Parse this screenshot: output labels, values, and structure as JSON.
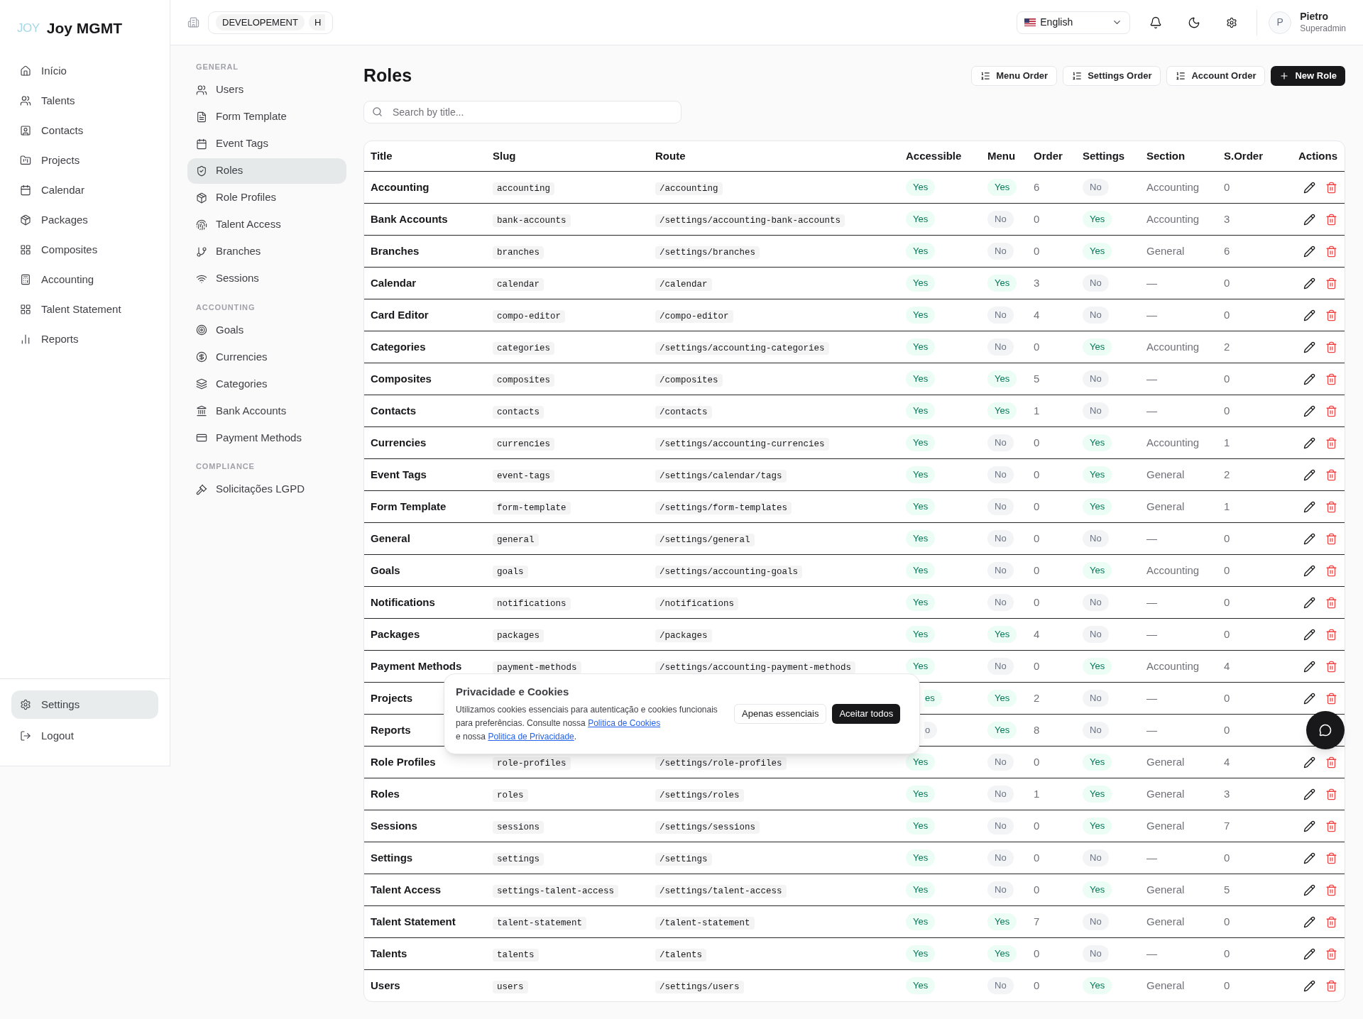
{
  "brand": {
    "mark": "JOY",
    "name": "Joy MGMT"
  },
  "nav": [
    {
      "label": "Início",
      "selected": false
    },
    {
      "label": "Talents",
      "selected": false
    },
    {
      "label": "Contacts",
      "selected": false
    },
    {
      "label": "Projects",
      "selected": false
    },
    {
      "label": "Calendar",
      "selected": false
    },
    {
      "label": "Packages",
      "selected": false
    },
    {
      "label": "Composites",
      "selected": false
    },
    {
      "label": "Accounting",
      "selected": false
    },
    {
      "label": "Talent Statement",
      "selected": false
    },
    {
      "label": "Reports",
      "selected": false
    }
  ],
  "footer_nav": [
    {
      "label": "Settings",
      "selected": true
    },
    {
      "label": "Logout",
      "selected": false
    }
  ],
  "topbar": {
    "environment": "DEVELOPEMENT",
    "branch": "H",
    "language": "English",
    "user": {
      "initial": "P",
      "name": "Pietro",
      "role": "Superadmin"
    }
  },
  "settings_nav": [
    {
      "heading": "GENERAL",
      "items": [
        {
          "label": "Users",
          "selected": false
        },
        {
          "label": "Form Template",
          "selected": false
        },
        {
          "label": "Event Tags",
          "selected": false
        },
        {
          "label": "Roles",
          "selected": true
        },
        {
          "label": "Role Profiles",
          "selected": false
        },
        {
          "label": "Talent Access",
          "selected": false
        },
        {
          "label": "Branches",
          "selected": false
        },
        {
          "label": "Sessions",
          "selected": false
        }
      ]
    },
    {
      "heading": "ACCOUNTING",
      "items": [
        {
          "label": "Goals",
          "selected": false
        },
        {
          "label": "Currencies",
          "selected": false
        },
        {
          "label": "Categories",
          "selected": false
        },
        {
          "label": "Bank Accounts",
          "selected": false
        },
        {
          "label": "Payment Methods",
          "selected": false
        }
      ]
    },
    {
      "heading": "COMPLIANCE",
      "items": [
        {
          "label": "Solicitações LGPD",
          "selected": false
        }
      ]
    }
  ],
  "page": {
    "title": "Roles",
    "actions": [
      "Menu Order",
      "Settings Order",
      "Account Order"
    ],
    "primary_action": "New Role",
    "search": {
      "placeholder": "Search by title..."
    }
  },
  "table": {
    "columns": [
      "Title",
      "Slug",
      "Route",
      "Accessible",
      "Menu",
      "Order",
      "Settings",
      "Section",
      "S.Order",
      "Actions"
    ],
    "rows": [
      {
        "title": "Accounting",
        "slug": "accounting",
        "route": "/accounting",
        "accessible": {
          "label": "Yes",
          "on": true
        },
        "menu": {
          "label": "Yes",
          "on": true
        },
        "order": "6",
        "settings": {
          "label": "No",
          "on": false
        },
        "section": "Accounting",
        "s_order": "0"
      },
      {
        "title": "Bank Accounts",
        "slug": "bank-accounts",
        "route": "/settings/accounting-bank-accounts",
        "accessible": {
          "label": "Yes",
          "on": true
        },
        "menu": {
          "label": "No",
          "on": false
        },
        "order": "0",
        "settings": {
          "label": "Yes",
          "on": true
        },
        "section": "Accounting",
        "s_order": "3"
      },
      {
        "title": "Branches",
        "slug": "branches",
        "route": "/settings/branches",
        "accessible": {
          "label": "Yes",
          "on": true
        },
        "menu": {
          "label": "No",
          "on": false
        },
        "order": "0",
        "settings": {
          "label": "Yes",
          "on": true
        },
        "section": "General",
        "s_order": "6"
      },
      {
        "title": "Calendar",
        "slug": "calendar",
        "route": "/calendar",
        "accessible": {
          "label": "Yes",
          "on": true
        },
        "menu": {
          "label": "Yes",
          "on": true
        },
        "order": "3",
        "settings": {
          "label": "No",
          "on": false
        },
        "section": "—",
        "s_order": "0"
      },
      {
        "title": "Card Editor",
        "slug": "compo-editor",
        "route": "/compo-editor",
        "accessible": {
          "label": "Yes",
          "on": true
        },
        "menu": {
          "label": "No",
          "on": false
        },
        "order": "4",
        "settings": {
          "label": "No",
          "on": false
        },
        "section": "—",
        "s_order": "0"
      },
      {
        "title": "Categories",
        "slug": "categories",
        "route": "/settings/accounting-categories",
        "accessible": {
          "label": "Yes",
          "on": true
        },
        "menu": {
          "label": "No",
          "on": false
        },
        "order": "0",
        "settings": {
          "label": "Yes",
          "on": true
        },
        "section": "Accounting",
        "s_order": "2"
      },
      {
        "title": "Composites",
        "slug": "composites",
        "route": "/composites",
        "accessible": {
          "label": "Yes",
          "on": true
        },
        "menu": {
          "label": "Yes",
          "on": true
        },
        "order": "5",
        "settings": {
          "label": "No",
          "on": false
        },
        "section": "—",
        "s_order": "0"
      },
      {
        "title": "Contacts",
        "slug": "contacts",
        "route": "/contacts",
        "accessible": {
          "label": "Yes",
          "on": true
        },
        "menu": {
          "label": "Yes",
          "on": true
        },
        "order": "1",
        "settings": {
          "label": "No",
          "on": false
        },
        "section": "—",
        "s_order": "0"
      },
      {
        "title": "Currencies",
        "slug": "currencies",
        "route": "/settings/accounting-currencies",
        "accessible": {
          "label": "Yes",
          "on": true
        },
        "menu": {
          "label": "No",
          "on": false
        },
        "order": "0",
        "settings": {
          "label": "Yes",
          "on": true
        },
        "section": "Accounting",
        "s_order": "1"
      },
      {
        "title": "Event Tags",
        "slug": "event-tags",
        "route": "/settings/calendar/tags",
        "accessible": {
          "label": "Yes",
          "on": true
        },
        "menu": {
          "label": "No",
          "on": false
        },
        "order": "0",
        "settings": {
          "label": "Yes",
          "on": true
        },
        "section": "General",
        "s_order": "2"
      },
      {
        "title": "Form Template",
        "slug": "form-template",
        "route": "/settings/form-templates",
        "accessible": {
          "label": "Yes",
          "on": true
        },
        "menu": {
          "label": "No",
          "on": false
        },
        "order": "0",
        "settings": {
          "label": "Yes",
          "on": true
        },
        "section": "General",
        "s_order": "1"
      },
      {
        "title": "General",
        "slug": "general",
        "route": "/settings/general",
        "accessible": {
          "label": "Yes",
          "on": true
        },
        "menu": {
          "label": "No",
          "on": false
        },
        "order": "0",
        "settings": {
          "label": "No",
          "on": false
        },
        "section": "—",
        "s_order": "0"
      },
      {
        "title": "Goals",
        "slug": "goals",
        "route": "/settings/accounting-goals",
        "accessible": {
          "label": "Yes",
          "on": true
        },
        "menu": {
          "label": "No",
          "on": false
        },
        "order": "0",
        "settings": {
          "label": "Yes",
          "on": true
        },
        "section": "Accounting",
        "s_order": "0"
      },
      {
        "title": "Notifications",
        "slug": "notifications",
        "route": "/notifications",
        "accessible": {
          "label": "Yes",
          "on": true
        },
        "menu": {
          "label": "No",
          "on": false
        },
        "order": "0",
        "settings": {
          "label": "No",
          "on": false
        },
        "section": "—",
        "s_order": "0"
      },
      {
        "title": "Packages",
        "slug": "packages",
        "route": "/packages",
        "accessible": {
          "label": "Yes",
          "on": true
        },
        "menu": {
          "label": "Yes",
          "on": true
        },
        "order": "4",
        "settings": {
          "label": "No",
          "on": false
        },
        "section": "—",
        "s_order": "0"
      },
      {
        "title": "Payment Methods",
        "slug": "payment-methods",
        "route": "/settings/accounting-payment-methods",
        "accessible": {
          "label": "Yes",
          "on": true
        },
        "menu": {
          "label": "No",
          "on": false
        },
        "order": "0",
        "settings": {
          "label": "Yes",
          "on": true
        },
        "section": "Accounting",
        "s_order": "4"
      },
      {
        "title": "Projects",
        "accessible": {
          "label": "es",
          "on": true,
          "partial": true
        },
        "menu": {
          "label": "Yes",
          "on": true
        },
        "order": "2",
        "settings": {
          "label": "No",
          "on": false
        },
        "section": "—",
        "s_order": "0"
      },
      {
        "title": "Reports",
        "actions_covered": true,
        "accessible": {
          "label": "o",
          "on": false,
          "partial": true
        },
        "menu": {
          "label": "Yes",
          "on": true
        },
        "order": "8",
        "settings": {
          "label": "No",
          "on": false
        },
        "section": "—",
        "s_order": "0"
      },
      {
        "title": "Role Profiles",
        "slug": "role-profiles",
        "route": "/settings/role-profiles",
        "accessible": {
          "label": "Yes",
          "on": true
        },
        "menu": {
          "label": "No",
          "on": false
        },
        "order": "0",
        "settings": {
          "label": "Yes",
          "on": true
        },
        "section": "General",
        "s_order": "4"
      },
      {
        "title": "Roles",
        "slug": "roles",
        "route": "/settings/roles",
        "accessible": {
          "label": "Yes",
          "on": true
        },
        "menu": {
          "label": "No",
          "on": false
        },
        "order": "1",
        "settings": {
          "label": "Yes",
          "on": true
        },
        "section": "General",
        "s_order": "3"
      },
      {
        "title": "Sessions",
        "slug": "sessions",
        "route": "/settings/sessions",
        "accessible": {
          "label": "Yes",
          "on": true
        },
        "menu": {
          "label": "No",
          "on": false
        },
        "order": "0",
        "settings": {
          "label": "Yes",
          "on": true
        },
        "section": "General",
        "s_order": "7"
      },
      {
        "title": "Settings",
        "slug": "settings",
        "route": "/settings",
        "accessible": {
          "label": "Yes",
          "on": true
        },
        "menu": {
          "label": "No",
          "on": false
        },
        "order": "0",
        "settings": {
          "label": "No",
          "on": false
        },
        "section": "—",
        "s_order": "0"
      },
      {
        "title": "Talent Access",
        "slug": "settings-talent-access",
        "route": "/settings/talent-access",
        "accessible": {
          "label": "Yes",
          "on": true
        },
        "menu": {
          "label": "No",
          "on": false
        },
        "order": "0",
        "settings": {
          "label": "Yes",
          "on": true
        },
        "section": "General",
        "s_order": "5"
      },
      {
        "title": "Talent Statement",
        "slug": "talent-statement",
        "route": "/talent-statement",
        "accessible": {
          "label": "Yes",
          "on": true
        },
        "menu": {
          "label": "Yes",
          "on": true
        },
        "order": "7",
        "settings": {
          "label": "No",
          "on": false
        },
        "section": "General",
        "s_order": "0"
      },
      {
        "title": "Talents",
        "slug": "talents",
        "route": "/talents",
        "accessible": {
          "label": "Yes",
          "on": true
        },
        "menu": {
          "label": "Yes",
          "on": true
        },
        "order": "0",
        "settings": {
          "label": "No",
          "on": false
        },
        "section": "—",
        "s_order": "0"
      },
      {
        "title": "Users",
        "slug": "users",
        "route": "/settings/users",
        "accessible": {
          "label": "Yes",
          "on": true
        },
        "menu": {
          "label": "No",
          "on": false
        },
        "order": "0",
        "settings": {
          "label": "Yes",
          "on": true
        },
        "section": "General",
        "s_order": "0"
      }
    ]
  },
  "cookie_banner": {
    "title": "Privacidade e Cookies",
    "text_before": "Utilizamos cookies essenciais para autenticação e cookies funcionais para preferências. Consulte nossa",
    "cookie_link": "Politica de Cookies",
    "text_middle": "e nossa",
    "privacy_link": "Politica de Privacidade",
    "text_after": ".",
    "buttons": [
      "Apenas essenciais",
      "Aceitar todos"
    ]
  }
}
